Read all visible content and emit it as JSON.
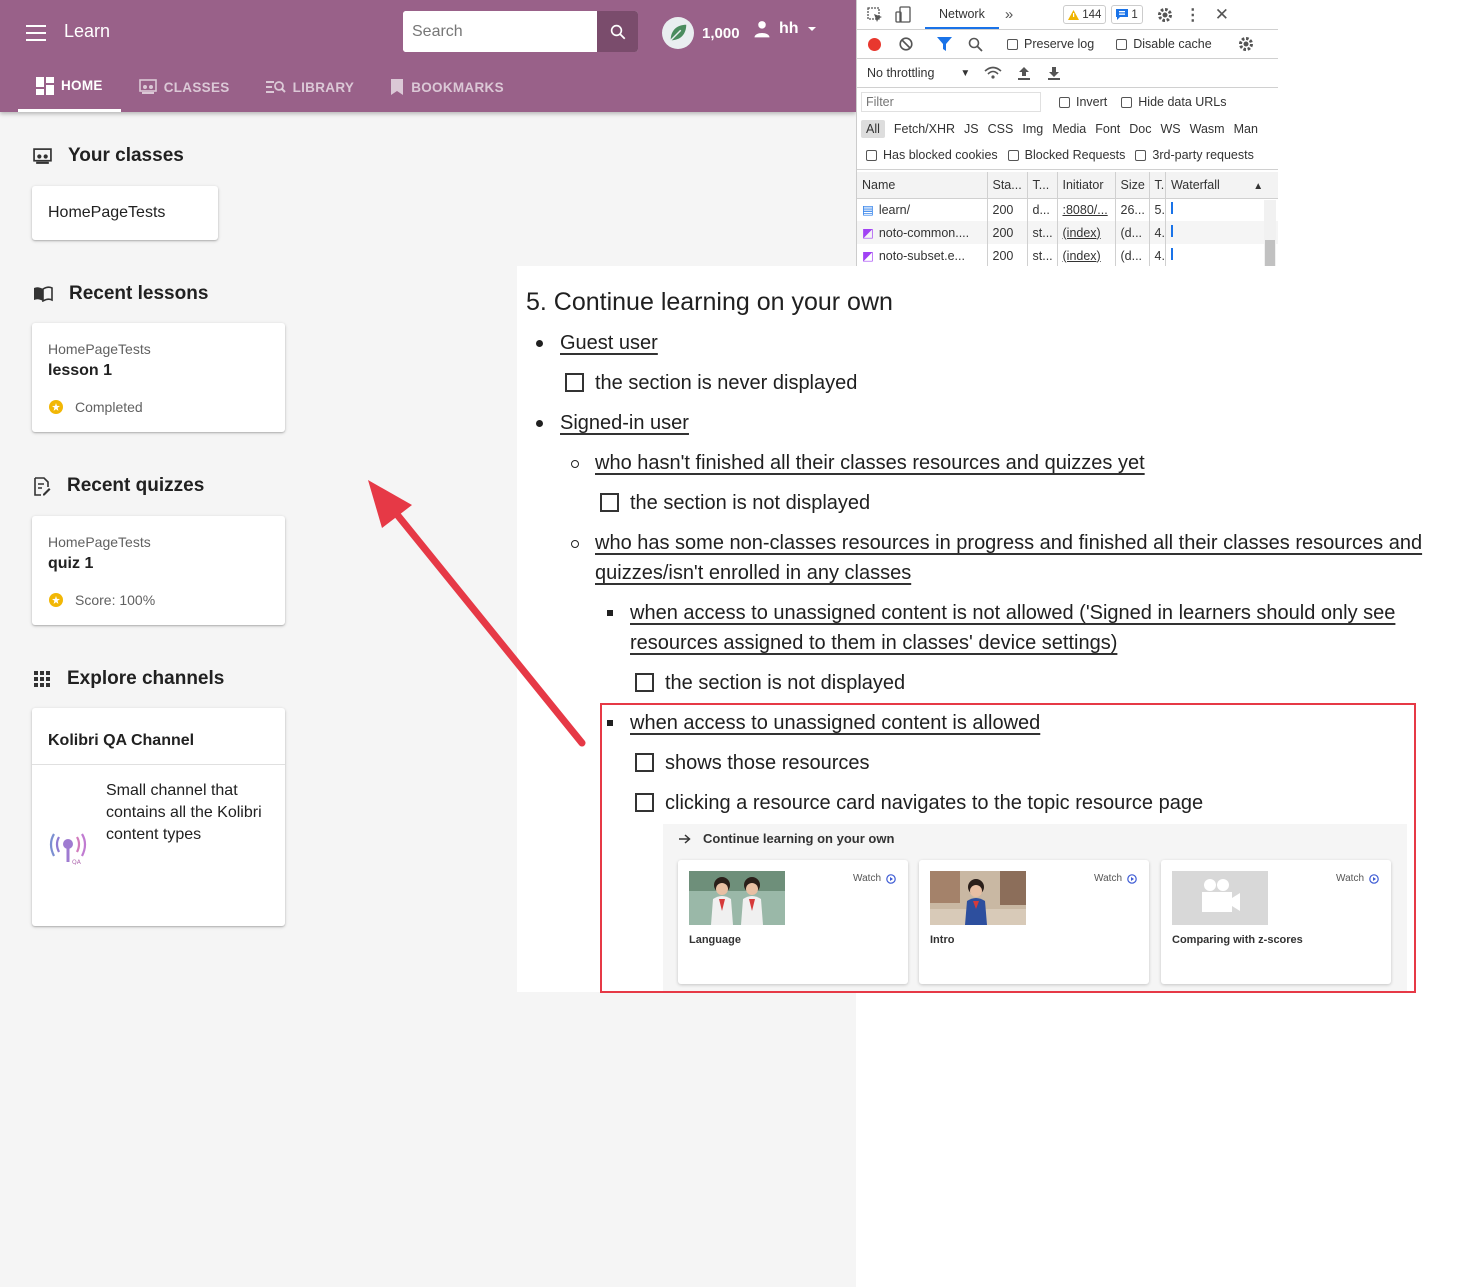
{
  "appbar": {
    "title": "Learn",
    "search_placeholder": "Search",
    "points": "1,000",
    "username": "hh",
    "tabs": [
      {
        "label": "HOME",
        "active": true
      },
      {
        "label": "CLASSES",
        "active": false
      },
      {
        "label": "LIBRARY",
        "active": false
      },
      {
        "label": "BOOKMARKS",
        "active": false
      }
    ],
    "bg_color": "#996189"
  },
  "home": {
    "your_classes": {
      "heading": "Your classes",
      "class_name": "HomePageTests"
    },
    "recent_lessons": {
      "heading": "Recent lessons",
      "class": "HomePageTests",
      "title": "lesson 1",
      "status": "Completed"
    },
    "recent_quizzes": {
      "heading": "Recent quizzes",
      "class": "HomePageTests",
      "title": "quiz 1",
      "status": "Score: 100%"
    },
    "explore_channels": {
      "heading": "Explore channels",
      "channel_title": "Kolibri QA Channel",
      "channel_description": "Small channel that contains all the Kolibri content types"
    }
  },
  "devtools": {
    "panel_tab": "Network",
    "warnings_count": "144",
    "messages_count": "1",
    "preserve_log": "Preserve log",
    "disable_cache": "Disable cache",
    "throttling": "No throttling",
    "filter_placeholder": "Filter",
    "invert": "Invert",
    "hide_data_urls": "Hide data URLs",
    "types": [
      "All",
      "Fetch/XHR",
      "JS",
      "CSS",
      "Img",
      "Media",
      "Font",
      "Doc",
      "WS",
      "Wasm",
      "Man"
    ],
    "blocked_cookies": "Has blocked cookies",
    "blocked_requests": "Blocked Requests",
    "third_party": "3rd-party requests",
    "columns": [
      "Name",
      "Sta...",
      "T...",
      "Initiator",
      "Size",
      "T.",
      "Waterfall"
    ],
    "rows": [
      {
        "name": "learn/",
        "status": "200",
        "type": "d...",
        "initiator": ":8080/...",
        "size": "26...",
        "time": "5."
      },
      {
        "name": "noto-common....",
        "status": "200",
        "type": "st...",
        "initiator": "(index)",
        "size": "(d...",
        "time": "4."
      },
      {
        "name": "noto-subset.e...",
        "status": "200",
        "type": "st...",
        "initiator": "(index)",
        "size": "(d...",
        "time": "4."
      }
    ]
  },
  "doc": {
    "title": "5. Continue learning on your own",
    "guest_user": "Guest user",
    "guest_check": "the section is never displayed",
    "signed_in_user": "Signed-in user",
    "not_finished": "who hasn't finished all their classes resources and quizzes yet",
    "not_finished_check": "the section is not displayed",
    "finished_line1": "who has some non-classes resources in progress and finished all their classes resources and",
    "finished_line2": "quizzes/isn't enrolled in any classes",
    "not_allowed_line1": "when access to unassigned content is not allowed ('Signed in learners should only see",
    "not_allowed_line2": "resources assigned to them in classes' device settings)",
    "not_allowed_check": "the section is not displayed",
    "allowed": "when access to unassigned content is allowed",
    "allowed_check1": "shows those resources",
    "allowed_check2": "clicking a resource card navigates to the topic resource page",
    "embed": {
      "title": "Continue learning on your own",
      "cards": [
        {
          "title": "Language",
          "action": "Watch"
        },
        {
          "title": "Intro",
          "action": "Watch"
        },
        {
          "title": "Comparing with z-scores",
          "action": "Watch"
        }
      ]
    }
  },
  "annotation_color": "#e63946"
}
